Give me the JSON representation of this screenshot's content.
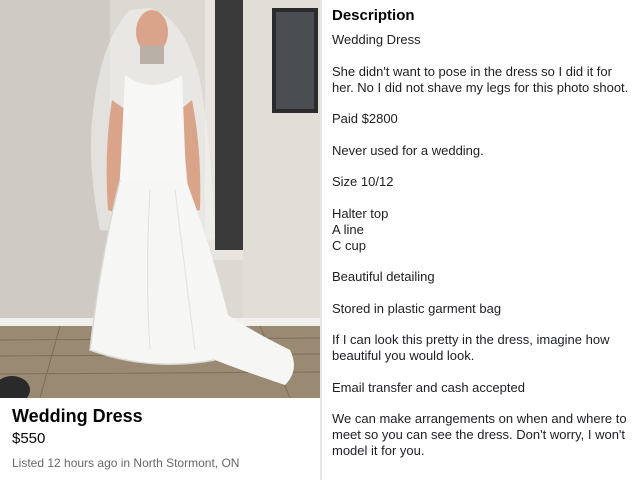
{
  "listing": {
    "title": "Wedding Dress",
    "price": "$550",
    "meta": "Listed 12 hours ago in North Stormont, ON",
    "photo_alt": "Man wearing a white strapless wedding dress and veil standing in a hallway"
  },
  "description": {
    "heading": "Description",
    "paragraphs": [
      "Wedding Dress",
      "She didn't want to pose in the dress so I did it for her.   No I did not shave my legs for this photo shoot.",
      "Paid $2800",
      "Never used for a wedding.",
      "Size 10/12",
      "Halter top\nA line\nC cup",
      "Beautiful detailing",
      "Stored in plastic garment bag",
      "If I can look this pretty in the dress, imagine how beautiful you would look.",
      "Email transfer and cash accepted",
      "We can make arrangements on when and where to meet so you can see the dress. Don't worry, I won't model it for you."
    ]
  },
  "colors": {
    "text": "#1c1e21",
    "muted": "#65676b",
    "divider": "#e4e6eb"
  }
}
